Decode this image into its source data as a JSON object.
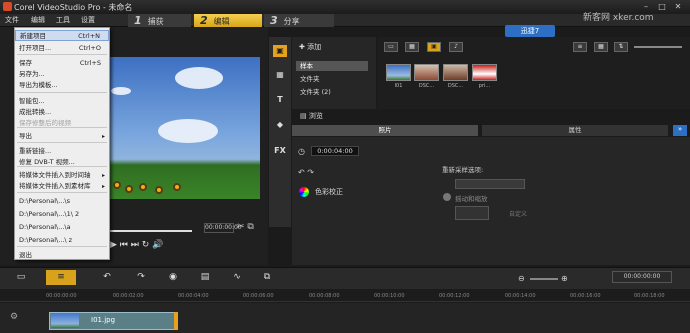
{
  "window": {
    "title": "Corel VideoStudio Pro - 未命名"
  },
  "menu": [
    "文件",
    "编辑",
    "工具",
    "设置"
  ],
  "steps": [
    {
      "num": "1",
      "label": "捕获"
    },
    {
      "num": "2",
      "label": "编辑"
    },
    {
      "num": "3",
      "label": "分享"
    }
  ],
  "watermark": "新客网 xker.com",
  "quick_button": "迅捷7",
  "file_menu": {
    "items": [
      {
        "label": "新建项目",
        "shortcut": "Ctrl+N",
        "highlight": true
      },
      {
        "label": "打开项目...",
        "shortcut": "Ctrl+O"
      },
      {
        "label": "保存",
        "shortcut": "Ctrl+S"
      },
      {
        "label": "另存为..."
      },
      {
        "label": "导出为模板..."
      },
      {
        "label": "智能包..."
      },
      {
        "label": "成批转换..."
      },
      {
        "label": "保存修整后的视频",
        "disabled": true
      },
      {
        "label": "导出",
        "submenu": true
      },
      {
        "label": "重新链接..."
      },
      {
        "label": "修复 DVB-T 视频..."
      },
      {
        "label": "将媒体文件插入到时间轴",
        "submenu": true
      },
      {
        "label": "将媒体文件插入到素材库",
        "submenu": true
      },
      {
        "label": "D:\\Personal\\...\\s"
      },
      {
        "label": "D:\\Personal\\...\\1\\ 2"
      },
      {
        "label": "D:\\Personal\\...\\a"
      },
      {
        "label": "D:\\Personal\\...\\ z"
      },
      {
        "label": "退出"
      }
    ]
  },
  "library": {
    "add_label": "添加",
    "tree": [
      "样本",
      "文件夹",
      "文件夹 (2)"
    ],
    "browse_label": "浏览",
    "thumbs": [
      "I01",
      "DSC...",
      "DSC...",
      "pri..."
    ]
  },
  "options": {
    "tabs": [
      "照片",
      "属性"
    ],
    "duration": "0:00:04:00",
    "color_correction": "色彩校正",
    "resample_label": "重新采样选项:",
    "pan_zoom": "摇动和缩放",
    "custom": "自定义"
  },
  "preview": {
    "timecode": "00:00:00:00"
  },
  "timeline": {
    "ticks": [
      "00:00:00:00",
      "00:00:02:00",
      "00:00:04:00",
      "00:00:06:00",
      "00:00:08:00",
      "00:00:10:00",
      "00:00:12:00",
      "00:00:14:00",
      "00:00:16:00",
      "00:00:18:00"
    ],
    "clip_label": "I01.jpg"
  }
}
